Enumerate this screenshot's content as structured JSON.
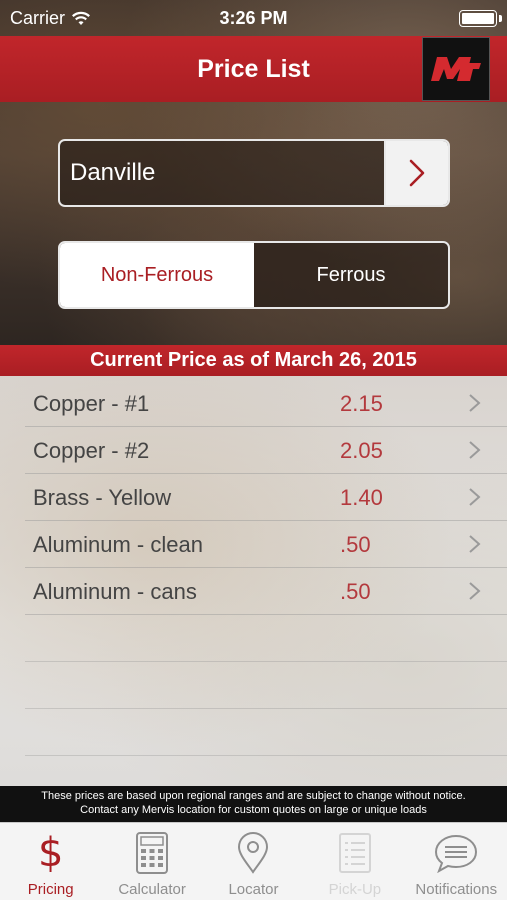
{
  "status_bar": {
    "carrier": "Carrier",
    "time": "3:26 PM"
  },
  "nav": {
    "title": "Price List"
  },
  "location": {
    "value": "Danville"
  },
  "segments": {
    "selected": "Non-Ferrous",
    "items": [
      "Non-Ferrous",
      "Ferrous"
    ]
  },
  "banner": {
    "text": "Current Price as of March 26, 2015"
  },
  "prices": [
    {
      "name": "Copper - #1",
      "price": "2.15"
    },
    {
      "name": "Copper - #2",
      "price": "2.05"
    },
    {
      "name": "Brass - Yellow",
      "price": "1.40"
    },
    {
      "name": "Aluminum - clean",
      "price": ".50"
    },
    {
      "name": "Aluminum - cans",
      "price": ".50"
    }
  ],
  "disclaimer": {
    "line1": "These prices are based upon regional ranges and are subject to change without notice.",
    "line2": "Contact any Mervis location for custom quotes on large or unique loads"
  },
  "tabs": [
    {
      "label": "Pricing",
      "icon": "dollar-icon",
      "state": "active"
    },
    {
      "label": "Calculator",
      "icon": "calculator-icon",
      "state": "normal"
    },
    {
      "label": "Locator",
      "icon": "map-pin-icon",
      "state": "normal"
    },
    {
      "label": "Pick-Up",
      "icon": "clipboard-icon",
      "state": "disabled"
    },
    {
      "label": "Notifications",
      "icon": "chat-bubble-icon",
      "state": "normal"
    }
  ],
  "colors": {
    "brand_red": "#a91e23",
    "price_red": "#b3393d",
    "tab_inactive": "#8e8e8e",
    "tab_disabled": "#d4d4d4"
  }
}
